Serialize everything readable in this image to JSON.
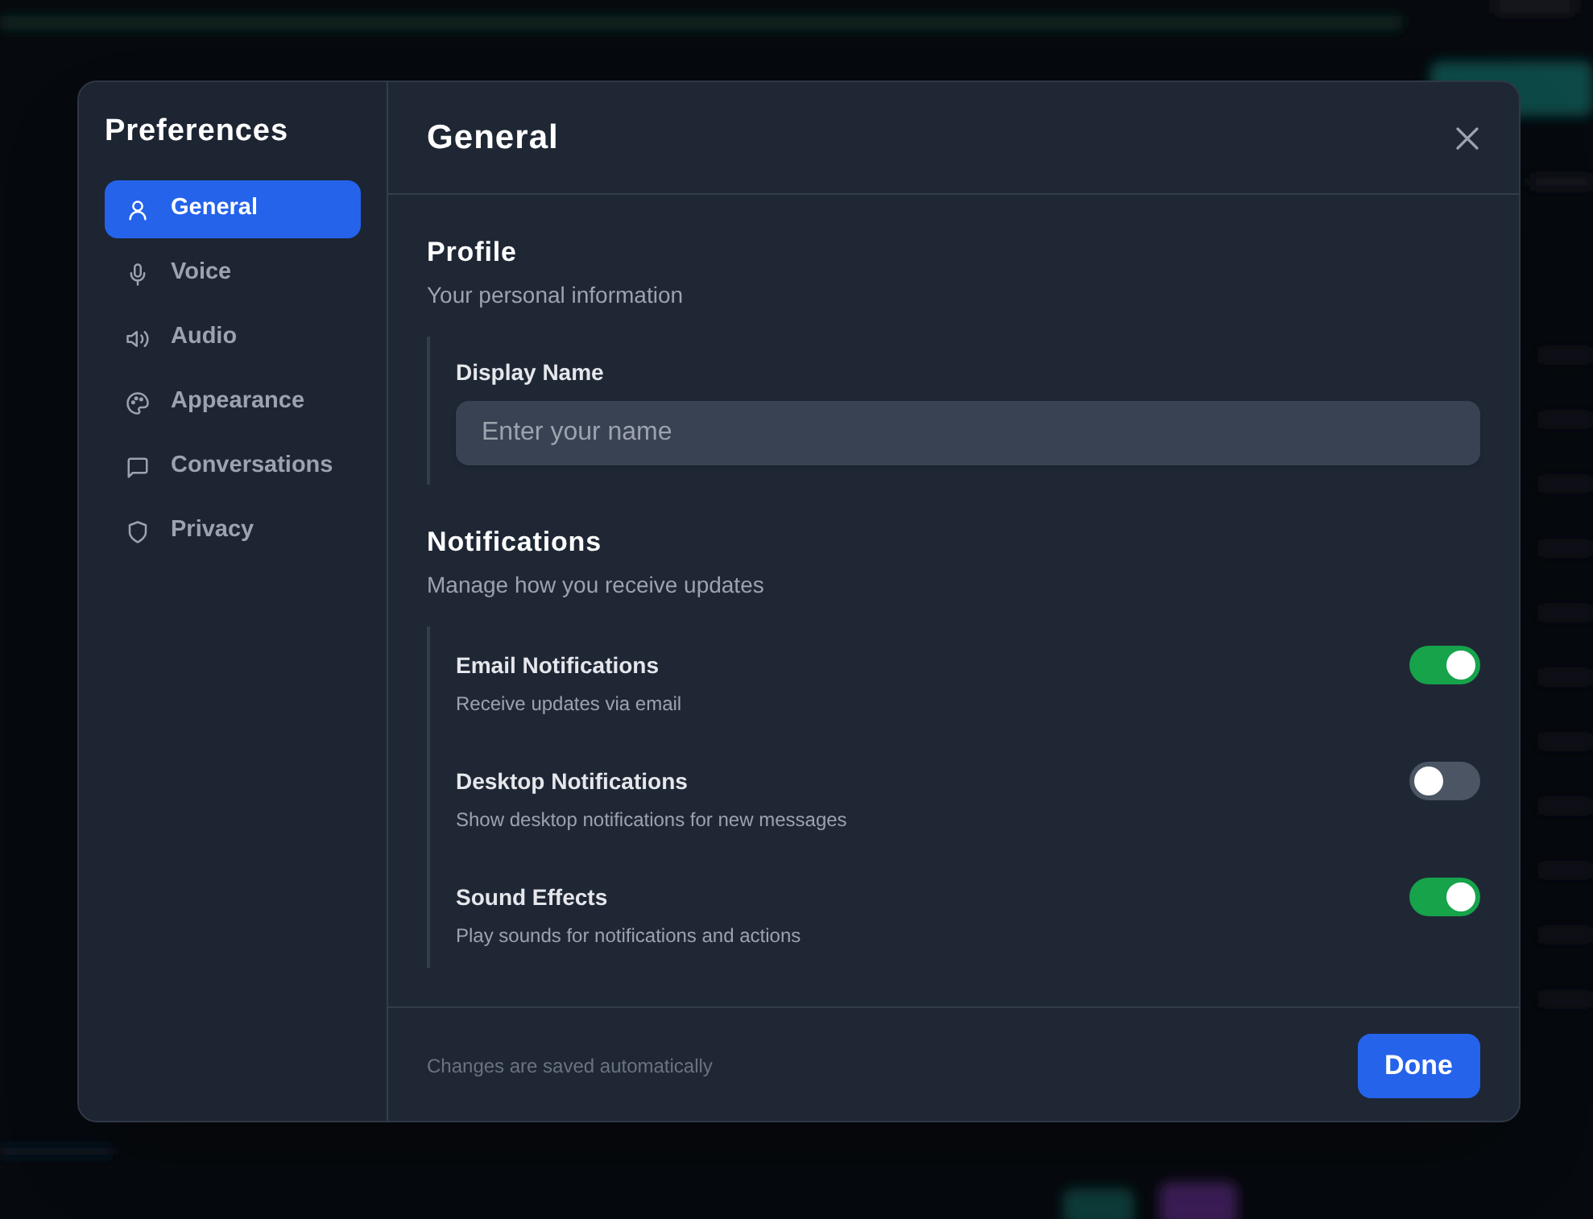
{
  "window": {
    "title": "Preferences"
  },
  "sidebar": {
    "items": [
      {
        "label": "General",
        "selected": true
      },
      {
        "label": "Voice",
        "selected": false
      },
      {
        "label": "Audio",
        "selected": false
      },
      {
        "label": "Appearance",
        "selected": false
      },
      {
        "label": "Conversations",
        "selected": false
      },
      {
        "label": "Privacy",
        "selected": false
      }
    ]
  },
  "panel": {
    "title": "General",
    "sections": [
      {
        "title": "Profile",
        "subtitle": "Your personal information",
        "fields": [
          {
            "kind": "text",
            "label": "Display Name",
            "placeholder": "Enter your name"
          }
        ]
      },
      {
        "title": "Notifications",
        "subtitle": "Manage how you receive updates",
        "fields": [
          {
            "kind": "toggle",
            "label": "Email Notifications",
            "description": "Receive updates via email",
            "on": true
          },
          {
            "kind": "toggle",
            "label": "Desktop Notifications",
            "description": "Show desktop notifications for new messages",
            "on": false
          },
          {
            "kind": "toggle",
            "label": "Sound Effects",
            "description": "Play sounds for notifications and actions",
            "on": true
          }
        ]
      }
    ]
  },
  "footer": {
    "note": "Changes are saved automatically",
    "button": "Done"
  }
}
